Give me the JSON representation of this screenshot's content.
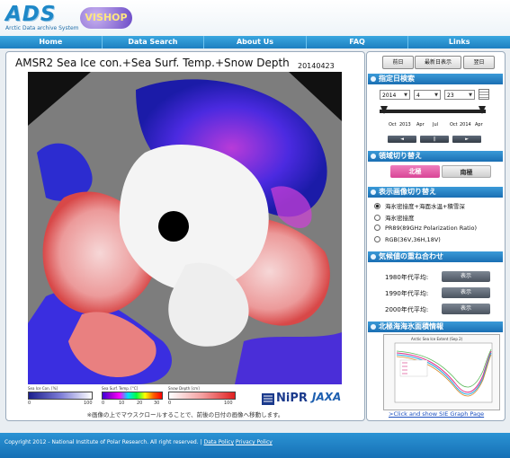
{
  "header": {
    "logo_text": "ADS",
    "logo_subtitle": "Arctic Data archive System",
    "logo2_text": "VISHOP"
  },
  "nav": {
    "items": [
      "Home",
      "Data Search",
      "About Us",
      "FAQ",
      "Links"
    ]
  },
  "main": {
    "title": "AMSR2 Sea Ice con.+Sea Surf. Temp.+Snow Depth",
    "date": "20140423",
    "legend": {
      "ice": {
        "label": "Sea Ice Con. [%]",
        "ticks": [
          "0",
          "100"
        ]
      },
      "sst": {
        "label": "Sea Surf. Temp. [°C]",
        "ticks": [
          "0",
          "10",
          "20",
          "30"
        ]
      },
      "snow": {
        "label": "Snow Depth [cm]",
        "ticks": [
          "0",
          "100"
        ]
      }
    },
    "nipr_logo": "NiPR",
    "jaxa_logo": "JAXA",
    "note": "※画像の上でマウスクロールすることで、前後の日付の画像へ移動します。"
  },
  "side": {
    "nav_buttons": [
      "前日",
      "最新日表示",
      "翌日"
    ],
    "date_section": "指定日検索",
    "year": "2014",
    "month": "4",
    "day": "23",
    "timeline_labels": [
      "Oct",
      "2013",
      "Apr",
      "Jul",
      "Oct",
      "2014",
      "Apr"
    ],
    "play_buttons": [
      "◄",
      "||",
      "►"
    ],
    "region_section": "領域切り替え",
    "north": "北極",
    "south": "南極",
    "image_section": "表示画像切り替え",
    "image_options": [
      "海氷密接度+海面水温+積雪深",
      "海氷密接度",
      "PR89(89GHz Polarization Ratio)",
      "RGB(36V,36H,18V)"
    ],
    "overlay_section": "気候値の重ね合わせ",
    "overlays": [
      {
        "label": "1980年代平均:",
        "button": "表示"
      },
      {
        "label": "1990年代平均:",
        "button": "表示"
      },
      {
        "label": "2000年代平均:",
        "button": "表示"
      }
    ],
    "sie_section": "北極海海氷面積情報",
    "sie_chart_title": "Arctic Sea Ice Extent (Sep 2)",
    "sie_link": ">Click and show SIE Graph Page"
  },
  "footer": {
    "copyright": "Copyright 2012 - National Institute of Polar Research. All right reserved. |",
    "links": [
      "Data Policy",
      "Privacy Policy"
    ]
  },
  "colors": {
    "nav_blue": "#1d7fc0",
    "section_blue": "#1a6fb3",
    "north_pink": "#e05aa5",
    "land_gray": "#7d7d7d",
    "ocean_blue": "#2a2ad8",
    "snow_red": "#e04040"
  }
}
